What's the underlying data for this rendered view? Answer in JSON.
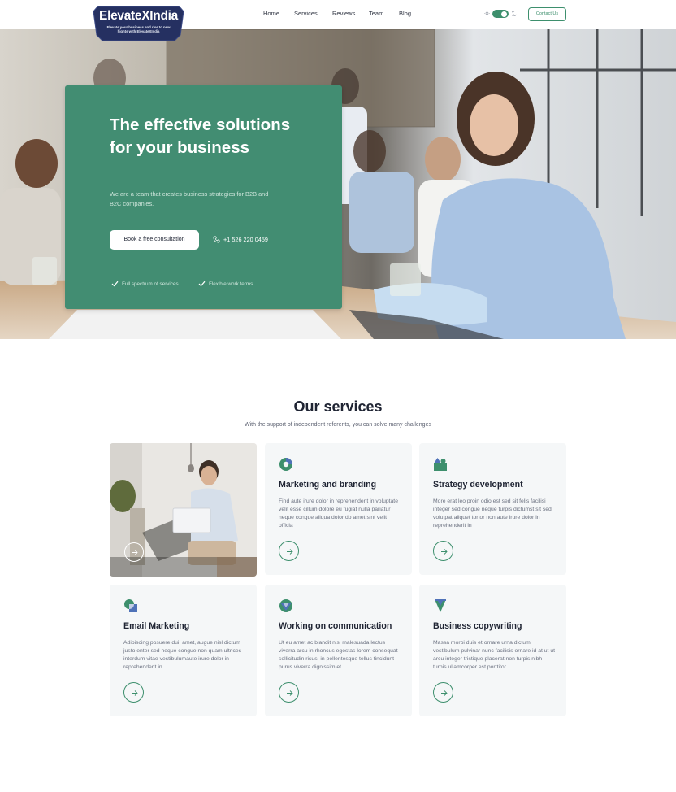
{
  "brand": {
    "name": "ElevateXIndia",
    "tagline": "Elevate your business and rise to new hights with ElevateXIndia"
  },
  "nav": {
    "items": [
      "Home",
      "Services",
      "Reviews",
      "Team",
      "Blog"
    ],
    "contact_label": "Contact Us"
  },
  "theme_toggle": {
    "mode": "dark",
    "on": true
  },
  "hero": {
    "title": "The effective solutions for your business",
    "subtitle": "We are a team that creates business strategies for B2B and B2C companies.",
    "cta_label": "Book a free consultation",
    "phone": "+1 526 220 0459",
    "features": [
      "Full spectrum of services",
      "Flexible work terms"
    ]
  },
  "services": {
    "title": "Our services",
    "subtitle": "With the support of independent referents, you can solve many challenges",
    "cards": [
      {
        "title": "Marketing and branding",
        "description": "Find aute irure dolor in reprehenderit in voluptate velit esse cillum dolore eu fugiat nulla pariatur neque congue aliqua dolor do amet sint velit officia",
        "icon": "pie-chart-icon"
      },
      {
        "title": "Strategy development",
        "description": "More erat leo proin odio est sed sit felis facilisi integer sed congue neque turpis dictumst sit sed volutpat aliquet tortor non aute irure dolor in reprehenderit in",
        "icon": "shapes-icon"
      },
      {
        "title": "Email Marketing",
        "description": "Adipiscing posuere dui, amet, augue nisl dictum justo enter sed neque congue non quam ultrices interdum vitae vestibulumaute irure dolor in reprehenderit in",
        "icon": "circle-square-icon"
      },
      {
        "title": "Working on communication",
        "description": "Ut eu amet ac blandit nisl malesuada lectus viverra arcu in rhoncus egestas lorem consequat sollicitudin risus, in pellentesque tellus tincidunt purus viverra dignissim et",
        "icon": "triangle-circle-icon"
      },
      {
        "title": "Business copywriting",
        "description": "Massa morbi duis et ornare urna dictum vestibulum pulvinar nunc facilisis ornare id at ut ut arcu integer tristique placerat non turpis nibh turpis ullamcorper est porttitor",
        "icon": "chevron-shield-icon"
      }
    ]
  },
  "colors": {
    "accent": "#3d8f6d",
    "hero_card": "#428d72",
    "icon_blue": "#4f72b8",
    "logo_bg": "#253061",
    "card_bg": "#f5f7f8"
  }
}
